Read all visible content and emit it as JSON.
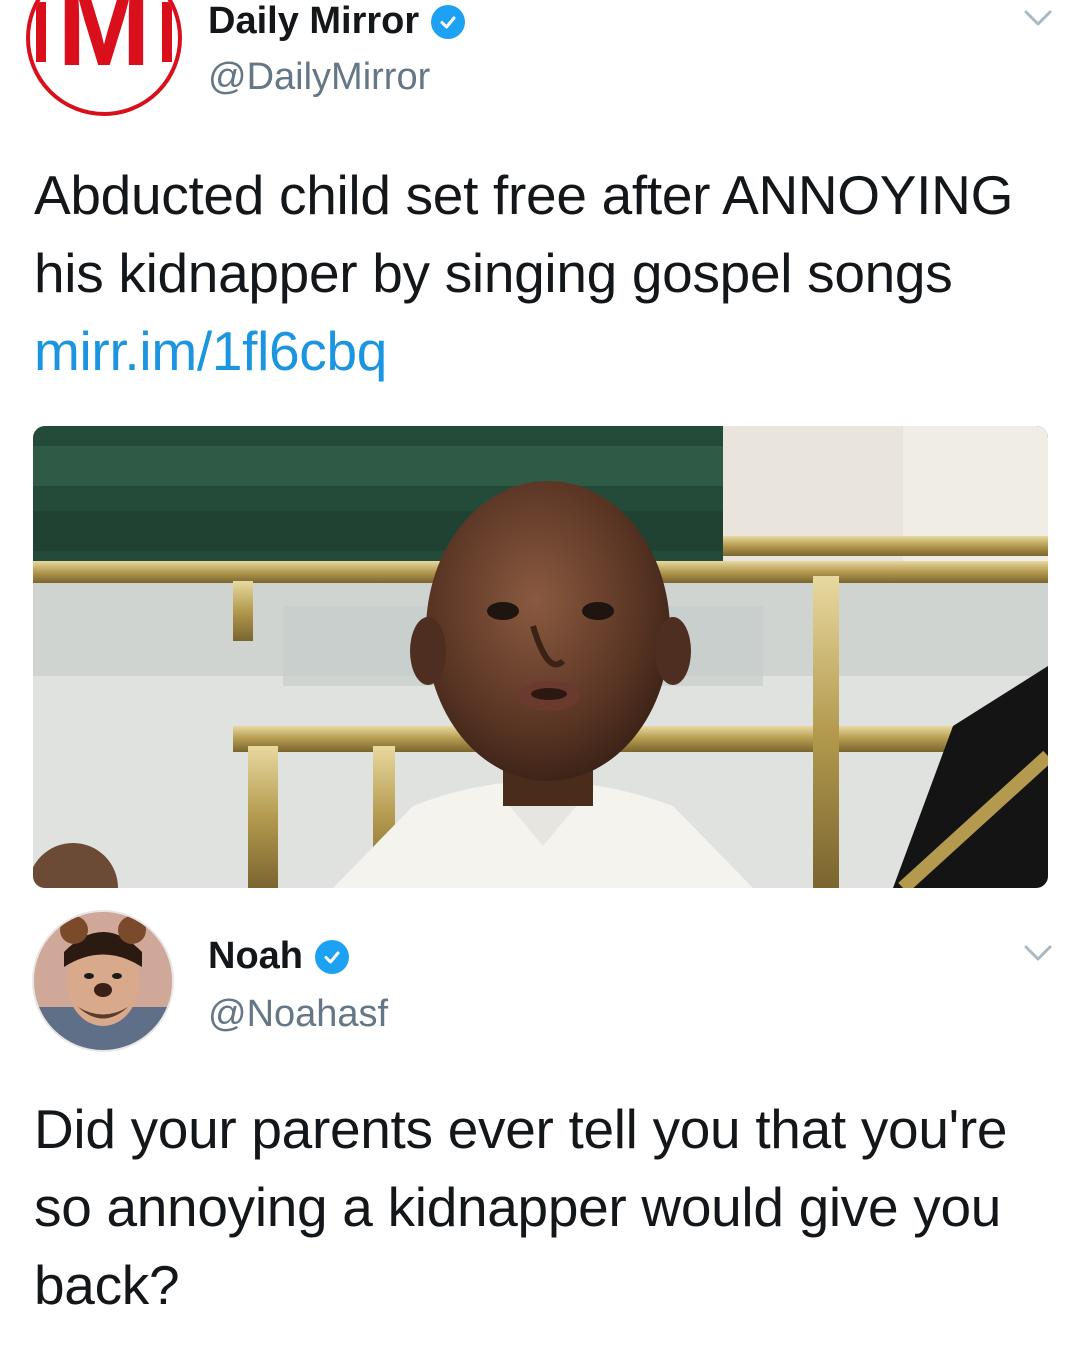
{
  "tweets": [
    {
      "name": "Daily Mirror",
      "handle": "@DailyMirror",
      "avatar_icon": "daily-mirror-logo",
      "avatar_letter": "M",
      "verified": true,
      "text": "Abducted child set free after ANNOYING his kidnapper by singing gospel songs",
      "link": "mirr.im/1fl6cbq",
      "media": "photo-child-church"
    },
    {
      "name": "Noah",
      "handle": "@Noahasf",
      "avatar_icon": "noah-avatar",
      "verified": true,
      "text": "Did your parents ever tell you that you're so annoying a kidnapper would give you back?"
    }
  ],
  "icons": {
    "verified": "verified-badge-icon",
    "chevron": "chevron-down-icon"
  },
  "colors": {
    "verified_blue": "#1da1f2",
    "link_blue": "#1b95e0",
    "mirror_red": "#d9101c",
    "handle_gray": "#657786"
  }
}
